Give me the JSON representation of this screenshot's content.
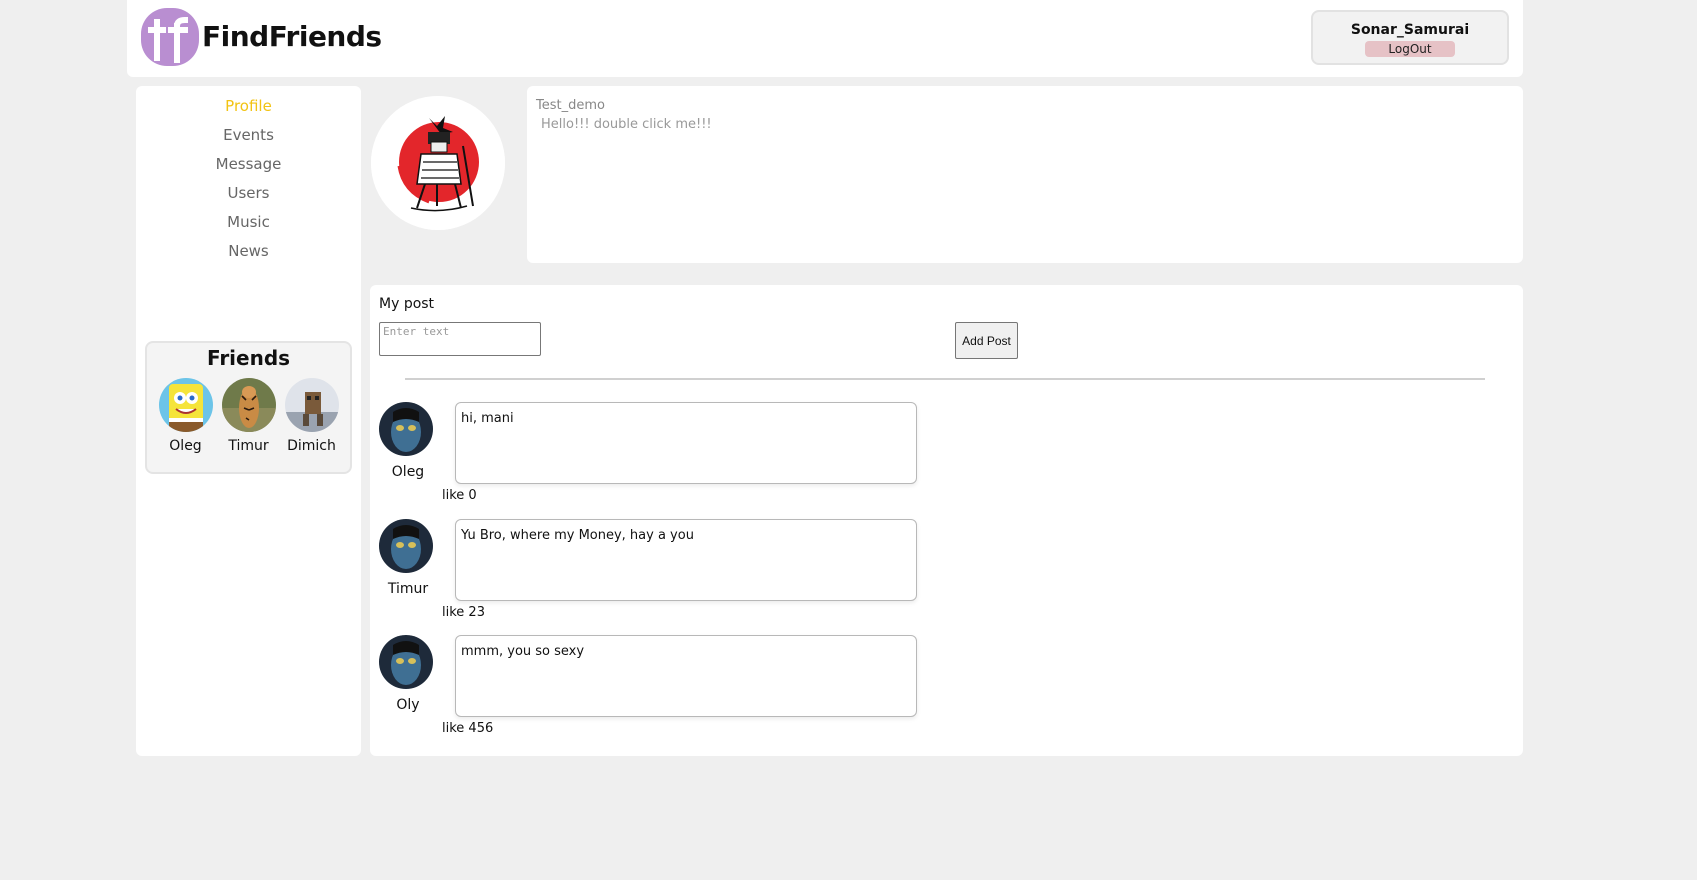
{
  "header": {
    "brand": "FindFriends",
    "user": {
      "name": "Sonar_Samurai",
      "logout_label": "LogOut"
    }
  },
  "nav": {
    "items": [
      {
        "label": "Profile",
        "active": true
      },
      {
        "label": "Events"
      },
      {
        "label": "Message"
      },
      {
        "label": "Users"
      },
      {
        "label": "Music"
      },
      {
        "label": "News"
      }
    ]
  },
  "friends": {
    "title": "Friends",
    "items": [
      {
        "name": "Oleg",
        "avatar": "sponge-avatar"
      },
      {
        "name": "Timur",
        "avatar": "tiger-avatar"
      },
      {
        "name": "Dimich",
        "avatar": "figure-avatar"
      }
    ]
  },
  "profile": {
    "avatar": "samurai-avatar",
    "name": "Test_demo",
    "status": "Hello!!! double click me!!!"
  },
  "posts": {
    "title": "My post",
    "input_placeholder": "Enter text",
    "add_label": "Add Post",
    "items": [
      {
        "author": "Oleg",
        "text": "hi, mani",
        "likes": "like 0"
      },
      {
        "author": "Timur",
        "text": "Yu Bro, where my Money, hay a you",
        "likes": "like 23"
      },
      {
        "author": "Oly",
        "text": "mmm, you so sexy",
        "likes": "like 456"
      }
    ]
  },
  "colors": {
    "accent_active": "#f2c313",
    "logo_purple": "#b98ed1",
    "logout_bg": "#e6c2c6",
    "samurai_red": "#e3262b"
  }
}
